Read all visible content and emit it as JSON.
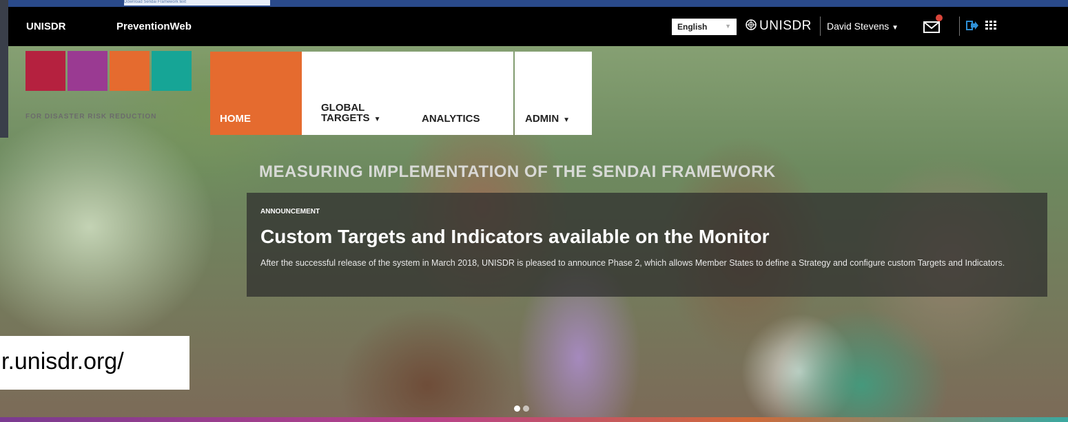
{
  "screen": {
    "strip_text": "Download Sendai Framework text"
  },
  "topbar": {
    "brand_unisdr": "UNISDR",
    "brand_preventionweb": "PreventionWeb",
    "language": "English",
    "org_name": "UNISDR",
    "user_name": "David Stevens",
    "user_caret": "▼"
  },
  "logo": {
    "tagline": "FOR DISASTER RISK REDUCTION",
    "colors": [
      "#b5213f",
      "#9a3a92",
      "#e56b2f",
      "#16a596"
    ]
  },
  "nav": {
    "home": "HOME",
    "global_targets_line1": "GLOBAL",
    "global_targets_line2": "TARGETS",
    "analytics": "ANALYTICS",
    "admin": "ADMIN",
    "caret": "▼"
  },
  "hero": {
    "title": "MEASURING IMPLEMENTATION OF THE SENDAI FRAMEWORK",
    "announcement_label": "ANNOUNCEMENT",
    "headline": "Custom Targets and Indicators available on the Monitor",
    "body": "After the successful release of the system in March 2018, UNISDR is pleased to announce Phase 2, which allows Member States to define a Strategy and configure custom Targets and Indicators."
  },
  "carousel": {
    "slides": 2,
    "active": 0
  },
  "url_overlay": "r.unisdr.org/",
  "colors": {
    "accent_orange": "#e56b2f",
    "topbar": "#000000"
  }
}
